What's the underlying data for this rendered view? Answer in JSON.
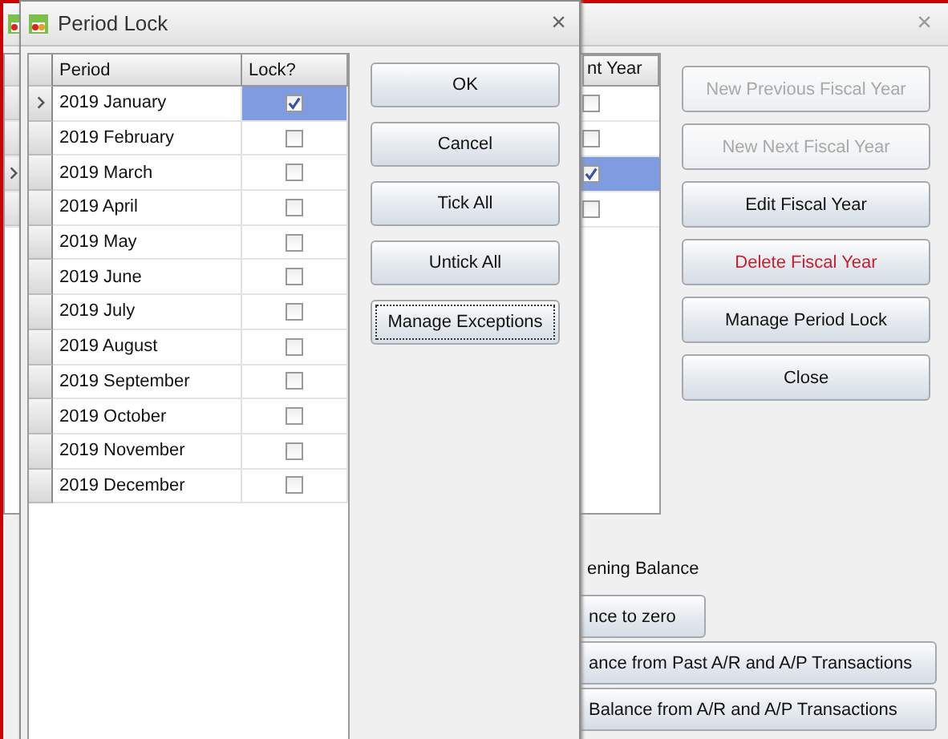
{
  "main_window": {
    "close": "×",
    "grid": {
      "column_header": "nt Year",
      "rows": [
        {
          "checked": false,
          "selected": false
        },
        {
          "checked": false,
          "selected": false
        },
        {
          "checked": true,
          "selected": true
        },
        {
          "checked": false,
          "selected": false
        }
      ]
    },
    "buttons": [
      {
        "label": "New Previous Fiscal Year",
        "disabled": true,
        "kind": "normal"
      },
      {
        "label": "New Next Fiscal Year",
        "disabled": true,
        "kind": "normal"
      },
      {
        "label": "Edit Fiscal Year",
        "disabled": false,
        "kind": "normal"
      },
      {
        "label": "Delete Fiscal Year",
        "disabled": false,
        "kind": "danger"
      },
      {
        "label": "Manage Period Lock",
        "disabled": false,
        "kind": "normal"
      },
      {
        "label": "Close",
        "disabled": false,
        "kind": "normal"
      }
    ],
    "opening_balance": {
      "label": "ening Balance",
      "buttons": [
        "nce to zero",
        "ance from Past A/R and A/P Transactions",
        "Balance from A/R and A/P Transactions"
      ]
    }
  },
  "dialog": {
    "title": "Period Lock",
    "close": "×",
    "columns": [
      "Period",
      "Lock?"
    ],
    "rows": [
      {
        "period": "2019 January",
        "checked": true,
        "selected": true
      },
      {
        "period": "2019 February",
        "checked": false,
        "selected": false
      },
      {
        "period": "2019 March",
        "checked": false,
        "selected": false
      },
      {
        "period": "2019 April",
        "checked": false,
        "selected": false
      },
      {
        "period": "2019 May",
        "checked": false,
        "selected": false
      },
      {
        "period": "2019 June",
        "checked": false,
        "selected": false
      },
      {
        "period": "2019 July",
        "checked": false,
        "selected": false
      },
      {
        "period": "2019 August",
        "checked": false,
        "selected": false
      },
      {
        "period": "2019 September",
        "checked": false,
        "selected": false
      },
      {
        "period": "2019 October",
        "checked": false,
        "selected": false
      },
      {
        "period": "2019 November",
        "checked": false,
        "selected": false
      },
      {
        "period": "2019 December",
        "checked": false,
        "selected": false
      }
    ],
    "buttons": [
      {
        "label": "OK",
        "focused": false
      },
      {
        "label": "Cancel",
        "focused": false
      },
      {
        "label": "Tick All",
        "focused": false
      },
      {
        "label": "Untick All",
        "focused": false
      },
      {
        "label": "Manage Exceptions",
        "focused": true
      }
    ]
  }
}
